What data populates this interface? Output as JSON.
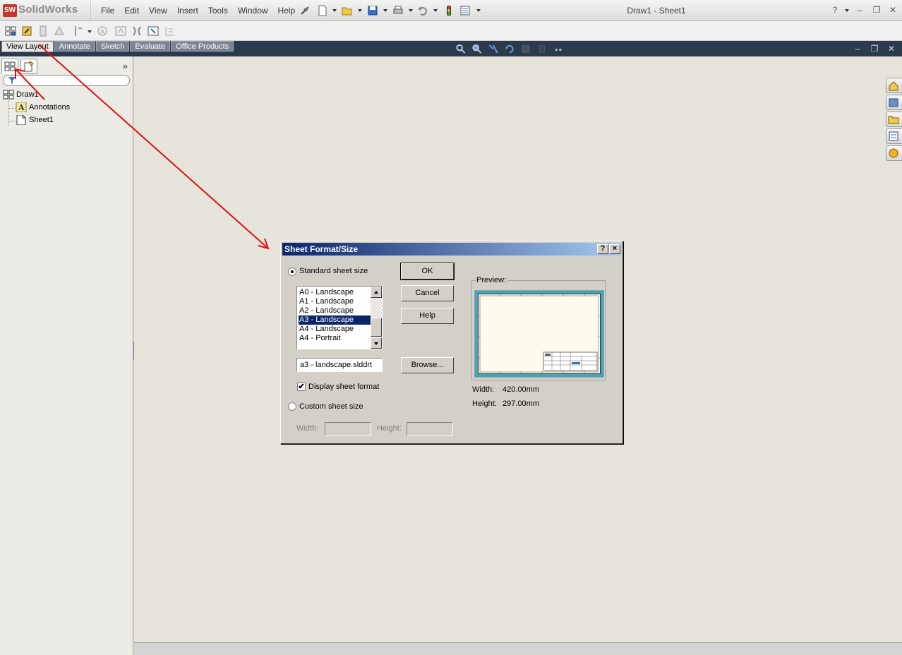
{
  "app": {
    "logo_text": "SolidWorks",
    "document_title": "Draw1 - Sheet1",
    "menu": [
      "File",
      "Edit",
      "View",
      "Insert",
      "Tools",
      "Window",
      "Help"
    ]
  },
  "command_manager": {
    "tabs": [
      "View Layout",
      "Annotate",
      "Sketch",
      "Evaluate",
      "Office Products"
    ],
    "active_tab": "View Layout"
  },
  "feature_tree": {
    "items": [
      {
        "label": "Draw1",
        "icon": "drawing-icon"
      },
      {
        "label": "Annotations",
        "icon": "annotations-icon"
      },
      {
        "label": "Sheet1",
        "icon": "sheet-icon"
      }
    ]
  },
  "dialog": {
    "title": "Sheet Format/Size",
    "help_button": "?",
    "close_button": "×",
    "standard_option": "Standard sheet size",
    "standard_selected": true,
    "sizes": [
      "A0 - Landscape",
      "A1 - Landscape",
      "A2 - Landscape",
      "A3 - Landscape",
      "A4 - Landscape",
      "A4 - Portrait"
    ],
    "selected_size": "A3 - Landscape",
    "format_file": "a3 - landscape.slddrt",
    "display_sheet_format_label": "Display sheet format",
    "display_sheet_format_checked": true,
    "check_mark": "✔",
    "custom_option": "Custom sheet size",
    "custom_width_label": "Width:",
    "custom_height_label": "Height:",
    "buttons": {
      "ok": "OK",
      "cancel": "Cancel",
      "help": "Help",
      "browse": "Browse..."
    },
    "preview_label": "Preview:",
    "width_label": "Width:",
    "width_value": "420.00mm",
    "height_label": "Height:",
    "height_value": "297.00mm"
  },
  "colors": {
    "annotation_arrow": "#e01010",
    "dialog_title_start": "#0a246a",
    "selection": "#0a246a",
    "preview_border": "#49a2b5"
  }
}
